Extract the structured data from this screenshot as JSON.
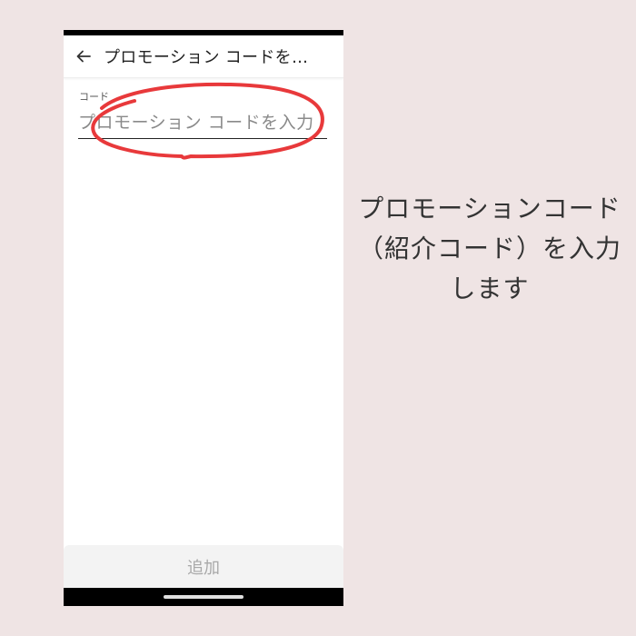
{
  "app_bar": {
    "title": "プロモーション コードを入力",
    "back_icon": "arrow-left-icon"
  },
  "form": {
    "field_label": "コード",
    "input_placeholder": "プロモーション コードを入力",
    "input_value": ""
  },
  "footer": {
    "add_label": "追加"
  },
  "caption": {
    "line1": "プロモーションコード",
    "line2": "（紹介コード）を入力",
    "line3": "します"
  },
  "colors": {
    "background": "#efe4e4",
    "annotation": "#e8393b",
    "button_background": "#f3f3f3",
    "button_text": "#a8a8a8"
  }
}
